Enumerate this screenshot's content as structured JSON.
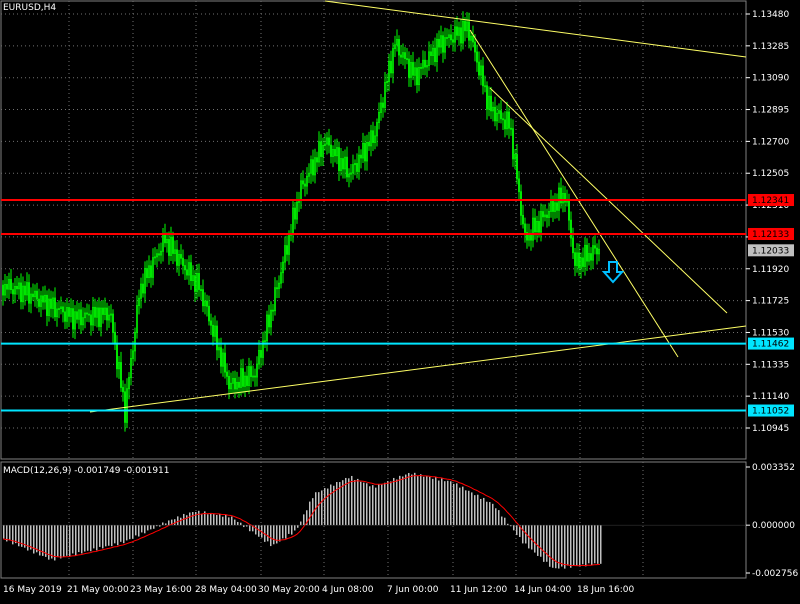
{
  "chart_data": [
    {
      "type": "candlestick",
      "title": "EURUSD,H4",
      "colors": {
        "background": "#000000",
        "grid": "#707070",
        "bull": "#00ff00",
        "text": "#ffffff"
      },
      "y_ticks": [
        "1.13480",
        "1.13285",
        "1.13090",
        "1.12895",
        "1.12700",
        "1.12505",
        "1.12310",
        "1.12115",
        "1.11920",
        "1.11725",
        "1.11530",
        "1.11335",
        "1.11140",
        "1.10945"
      ],
      "x_ticks": [
        "16 May 2019",
        "21 May 00:00",
        "23 May 16:00",
        "28 May 04:00",
        "30 May 20:00",
        "4 Jun 08:00",
        "7 Jun 00:00",
        "11 Jun 12:00",
        "14 Jun 04:00",
        "18 Jun 16:00"
      ],
      "ylim": [
        1.10845,
        1.1354
      ],
      "horizontal_levels": [
        {
          "label": "1.12341",
          "value": 1.12341,
          "color": "#ff0000"
        },
        {
          "label": "1.12133",
          "value": 1.12133,
          "color": "#ff0000"
        },
        {
          "label": "1.11462",
          "value": 1.11462,
          "color": "#00e5ff"
        },
        {
          "label": "1.11052",
          "value": 1.11052,
          "color": "#00e5ff"
        }
      ],
      "current_price": {
        "label": "1.12033",
        "value": 1.12033
      },
      "trendlines_color": "#ffff66",
      "arrow": {
        "direction": "down",
        "color": "#00bfff"
      }
    },
    {
      "type": "macd",
      "label": "MACD(12,26,9)",
      "main_value": "-0.001749",
      "signal_value": "-0.001911",
      "y_ticks": [
        "0.003352",
        "0.000000",
        "-0.002756"
      ],
      "ylim": [
        -0.003,
        0.0035
      ],
      "colors": {
        "histogram": "#c0c0c0",
        "signal": "#ff0000"
      }
    }
  ]
}
